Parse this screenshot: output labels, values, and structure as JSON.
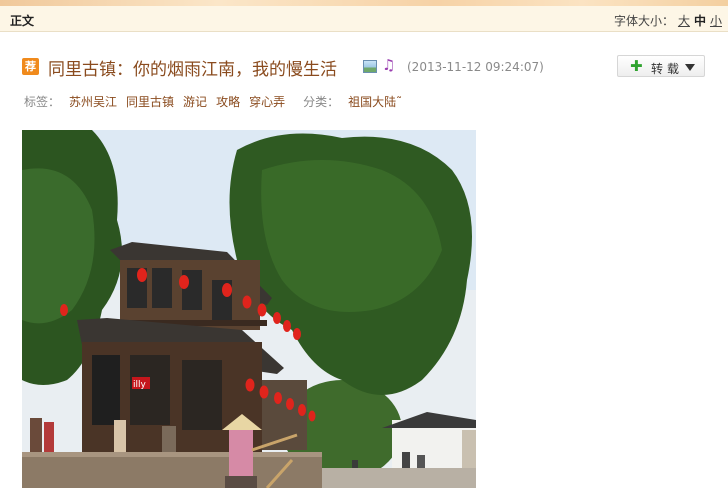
{
  "header": {
    "section_label": "正文",
    "font_size_label": "字体大小：",
    "font_size_options": [
      "大",
      "中",
      "小"
    ],
    "active_font_size": "中"
  },
  "post": {
    "recommend_badge": "荐",
    "title": "同里古镇：你的烟雨江南，我的慢生活",
    "timestamp": "(2013-11-12 09:24:07)",
    "icons": [
      "picture-icon",
      "music-note-icon"
    ]
  },
  "repost": {
    "label": "转载"
  },
  "meta": {
    "tags_label": "标签：",
    "tags": [
      "苏州吴江",
      "同里古镇",
      "游记",
      "攻略",
      "穿心弄"
    ],
    "category_label": "分类：",
    "category": "祖国大陆˜"
  },
  "photo": {
    "sign_text": "illy",
    "colors": {
      "lantern": "#e0241c",
      "sky": "#dde9f4",
      "foliage": "#2f5a22"
    }
  }
}
